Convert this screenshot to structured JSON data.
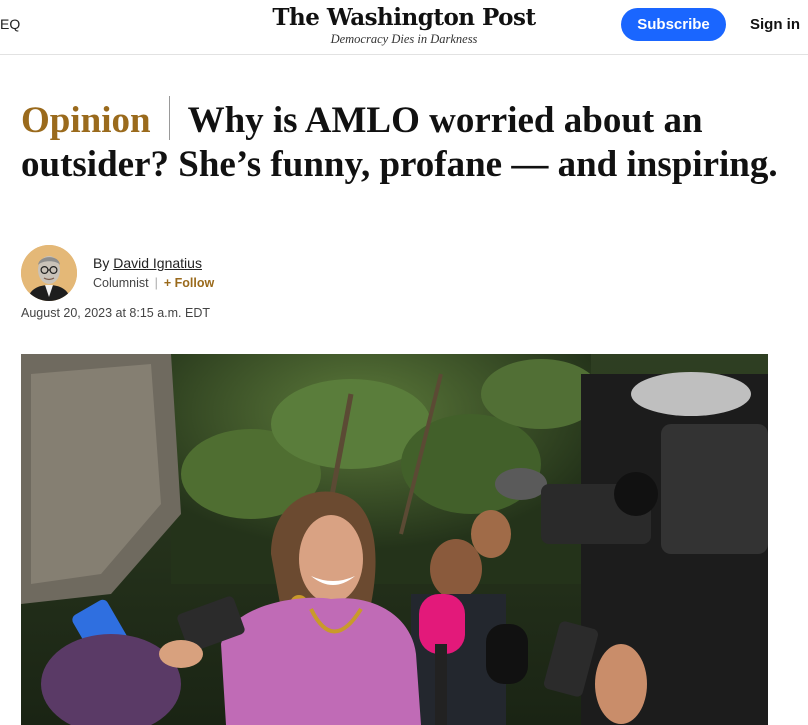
{
  "header": {
    "menu_edge_text": "EQ",
    "logo": "The Washington Post",
    "tagline": "Democracy Dies in Darkness",
    "subscribe_label": "Subscribe",
    "signin_label": "Sign in"
  },
  "article": {
    "kicker": "Opinion",
    "title": "Why is AMLO worried about an outsider? She’s funny, profane — and inspiring.",
    "byline_prefix": "By",
    "author": "David Ignatius",
    "role": "Columnist",
    "follow_label": "+ Follow",
    "date": "August 20, 2023 at 8:15 a.m. EDT"
  },
  "colors": {
    "accent_opinion": "#9a6a1c",
    "subscribe_bg": "#1a66ff"
  }
}
